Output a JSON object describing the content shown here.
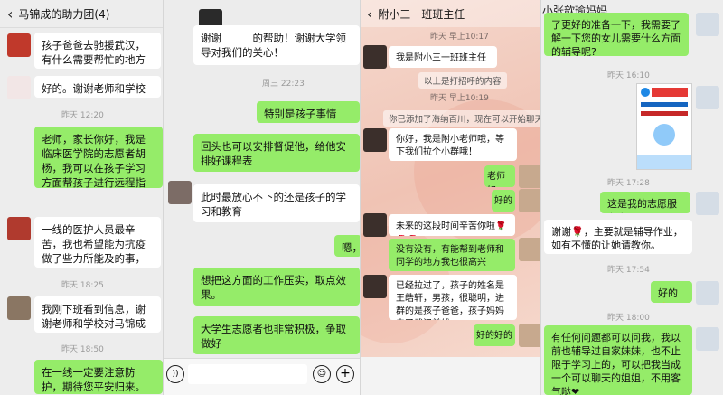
{
  "panel1": {
    "title": "马锦成的助力团(4)",
    "messages": [
      {
        "text": "孩子爸爸去驰援武汉，有什么需要帮忙的地方尽管说@糯儿米"
      },
      {
        "text": "好的。谢谢老师和学校的关心"
      },
      {
        "time": "昨天 12:20"
      },
      {
        "text": "老师，家长你好，我是临床医学院的志愿者胡杨，我可以在孩子学习方面帮孩子进行远程指导，如果有其他需要帮助的也可以和我说，我会尽我努力去帮你的"
      },
      {
        "text": "一线的医护人员最辛苦，我也希望能为抗疫做了些力所能及的事，为抗击疫情出一份力"
      },
      {
        "time": "昨天 18:25"
      },
      {
        "text": "我刚下班看到信息，谢谢老师和学校对马锦成的关心！"
      },
      {
        "time": "昨天 18:50"
      },
      {
        "text": "在一线一定要注意防护，期待您平安归来。"
      }
    ]
  },
  "panel2": {
    "messages": [
      {
        "text": "谢谢　　　的帮助！谢谢大学领导对我们的关心！"
      },
      {
        "time": "周三 22:23"
      },
      {
        "text": "特别是孩子事情"
      },
      {
        "text": "回头也可以安排督促他，给他安排好课程表"
      },
      {
        "text": "此时最放心不下的还是孩子的学习和教育"
      },
      {
        "text": "嗯，"
      },
      {
        "text": "想把这方面的工作压实，取点效果。"
      },
      {
        "text": "大学生志愿者也非常积极，争取做好"
      }
    ],
    "input": {
      "voice_icon": "voice-icon",
      "emoji_icon": "emoji-icon",
      "plus_icon": "plus-icon"
    }
  },
  "panel3": {
    "title": "附小三一班班主任",
    "messages": [
      {
        "time": "昨天 早上10:17"
      },
      {
        "text": "我是附小三一班班主任"
      },
      {
        "note": "以上是打招呼的内容"
      },
      {
        "time": "昨天 早上10:19"
      },
      {
        "note": "你已添加了海纳百川，现在可以开始聊天了。"
      },
      {
        "text": "你好，我是附小老师哦，等下我们拉个小群哦！"
      },
      {
        "text": "老师好"
      },
      {
        "text": "好的"
      },
      {
        "text": "未来的这段时间辛苦你啦🌹🌹🌹"
      },
      {
        "text": "没有没有，有能帮到老师和同学的地方我也很高兴"
      },
      {
        "text": "已经拉过了，孩子的姓名是王皓轩，男孩，很聪明，进群的是孩子爸爸，孩子妈妈去了武汉前线"
      },
      {
        "text": "好的好的"
      }
    ]
  },
  "panel4": {
    "title": "小张歆瑜妈妈",
    "messages": [
      {
        "text": "了更好的准备一下，我需要了解一下您的女儿需要什么方面的辅导呢?"
      },
      {
        "time": "昨天 16:10"
      },
      {
        "card_alt": "志愿服务卡"
      },
      {
        "time": "昨天 17:28"
      },
      {
        "text": "这是我的志愿服务卡"
      },
      {
        "text": "谢谢🌹，主要就是辅导作业，如有不懂的让她请教你。"
      },
      {
        "time": "昨天 17:54"
      },
      {
        "text": "好的👌"
      },
      {
        "time": "昨天 18:00"
      },
      {
        "text": "有任何问题都可以问我，我以前也辅导过自家妹妹，也不止限于学习上的，可以把我当成一个可以聊天的姐姐，不用客气哒❤"
      }
    ]
  },
  "colors": {
    "bg": "#ededed",
    "green_bubble": "#95ec69",
    "white_bubble": "#ffffff",
    "pink_wallpaper": "#f3c7bb"
  }
}
